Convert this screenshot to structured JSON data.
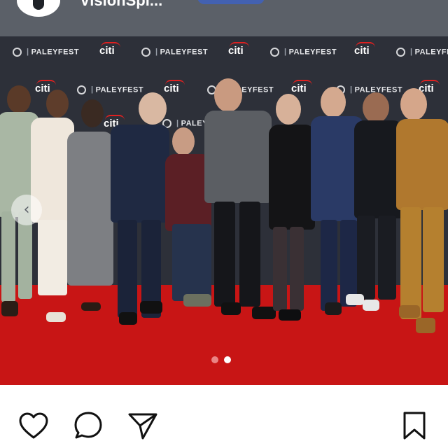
{
  "header": {
    "username": "VisionSpi...",
    "avatar_icon": "avatar-icon"
  },
  "post": {
    "backdrop_brand": "PALEYFEST",
    "sponsor": "citi",
    "carousel": {
      "current_slide": 2,
      "total_slides": 2
    },
    "colors": {
      "backdrop": "#2d3039",
      "carpet": "#c81515"
    }
  },
  "actions": {
    "like_icon": "heart-icon",
    "comment_icon": "comment-icon",
    "share_icon": "send-icon",
    "save_icon": "bookmark-icon"
  }
}
